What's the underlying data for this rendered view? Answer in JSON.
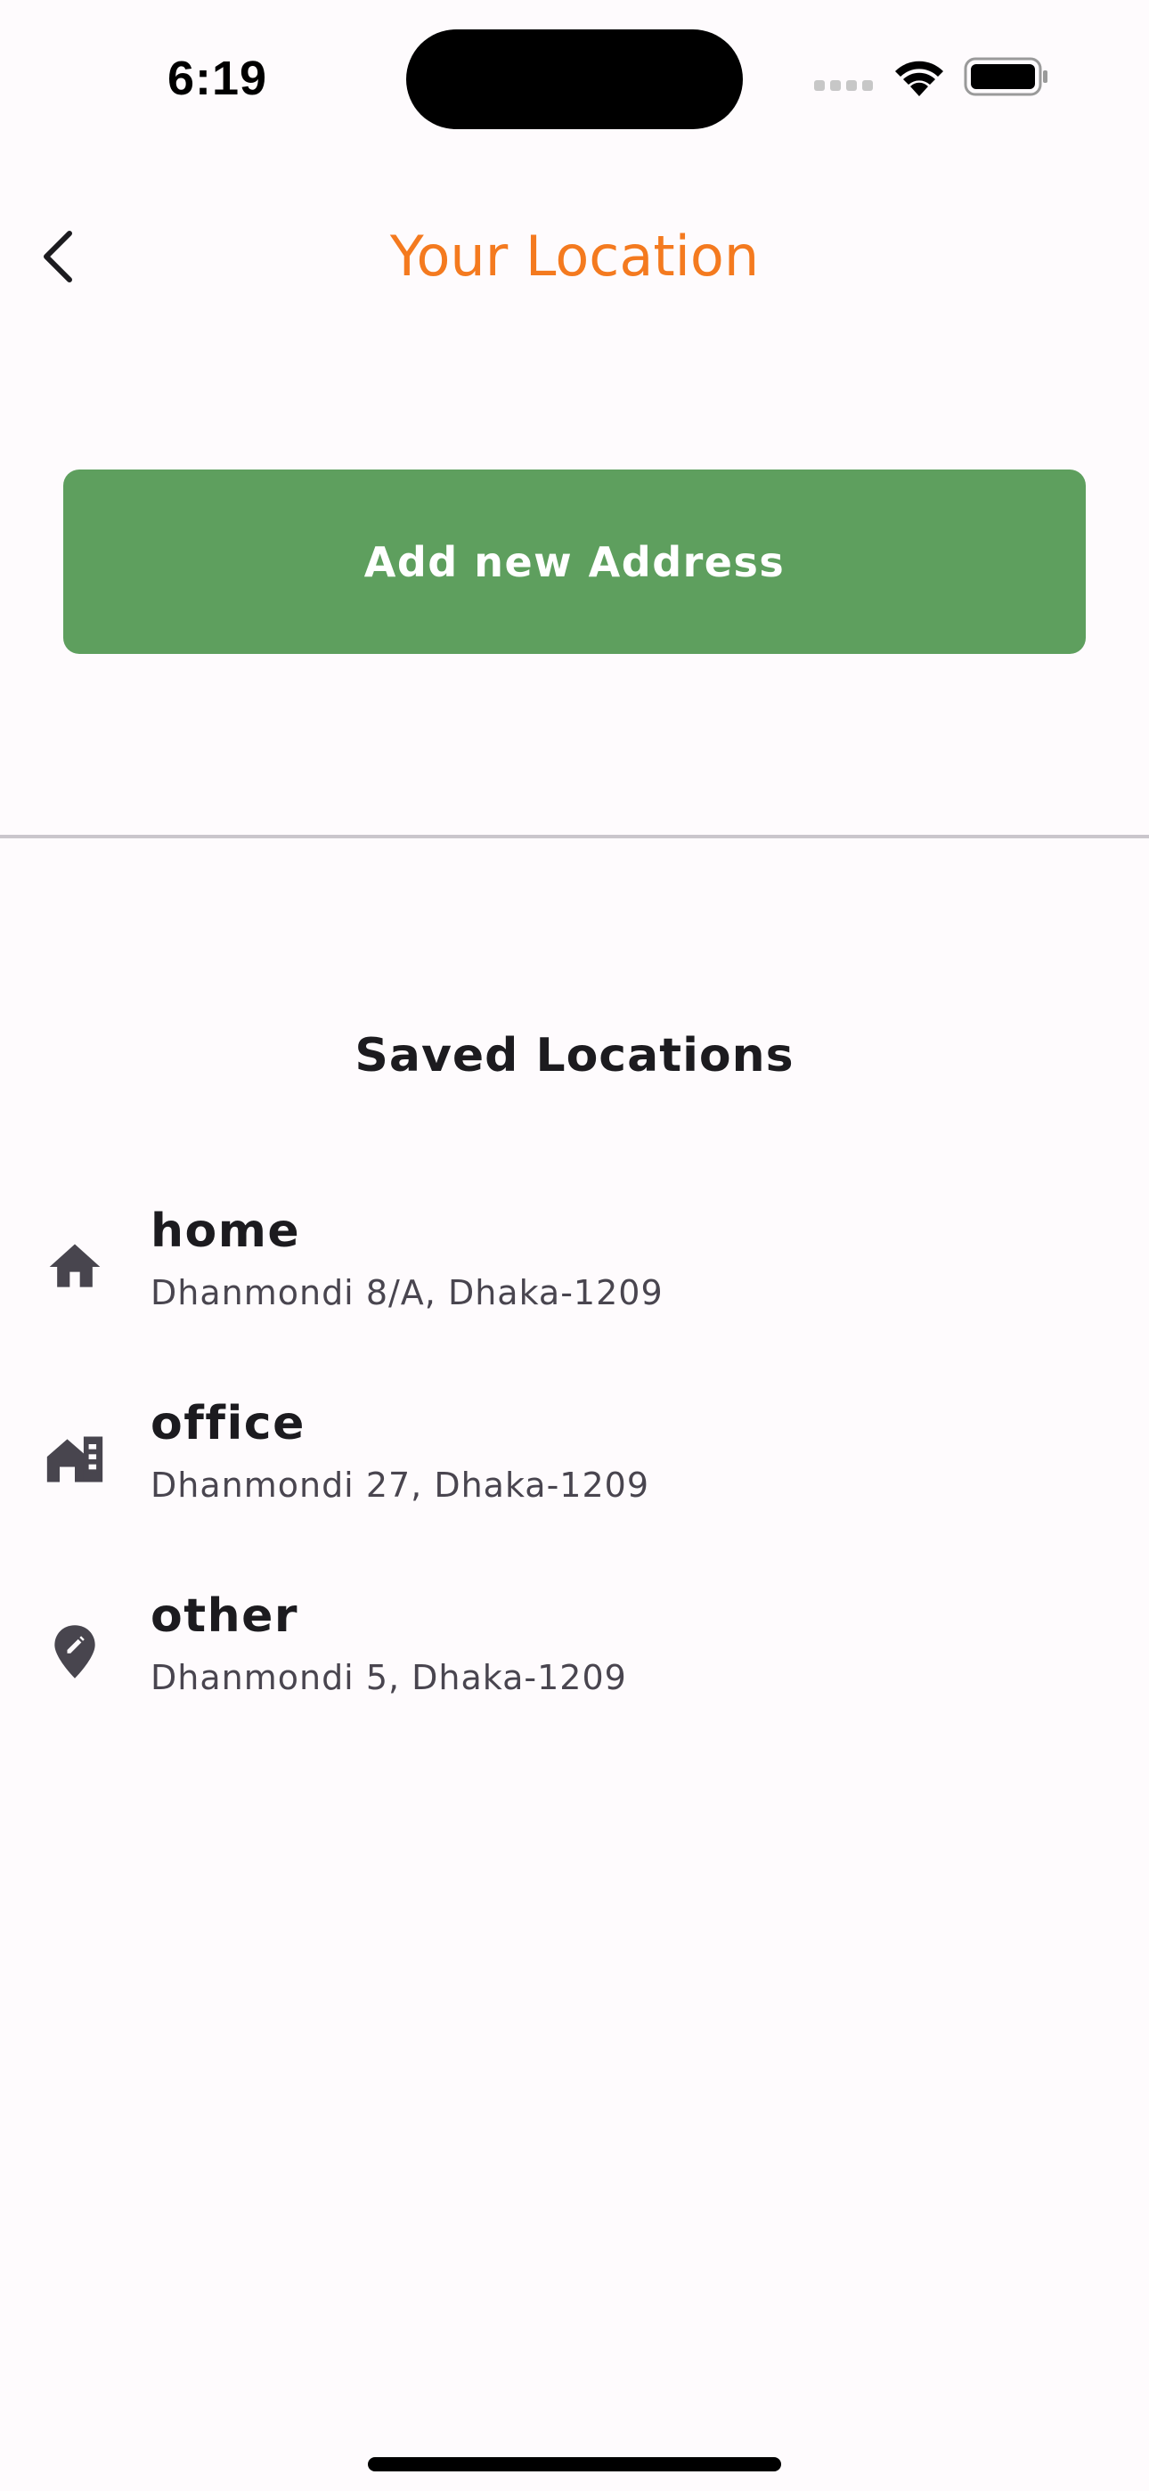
{
  "status_bar": {
    "time": "6:19"
  },
  "app_bar": {
    "title": "Your Location",
    "back_icon": "chevron-left-icon",
    "title_color": "#f47a1f"
  },
  "add_button": {
    "label": "Add new Address",
    "color": "#5e9f5e"
  },
  "saved_section": {
    "title": "Saved Locations"
  },
  "locations": [
    {
      "name": "home",
      "address": "Dhanmondi 8/A, Dhaka-1209",
      "icon": "home-icon"
    },
    {
      "name": "office",
      "address": "Dhanmondi 27, Dhaka-1209",
      "icon": "office-building-icon"
    },
    {
      "name": "other",
      "address": "Dhanmondi 5, Dhaka-1209",
      "icon": "edit-location-pin-icon"
    }
  ]
}
